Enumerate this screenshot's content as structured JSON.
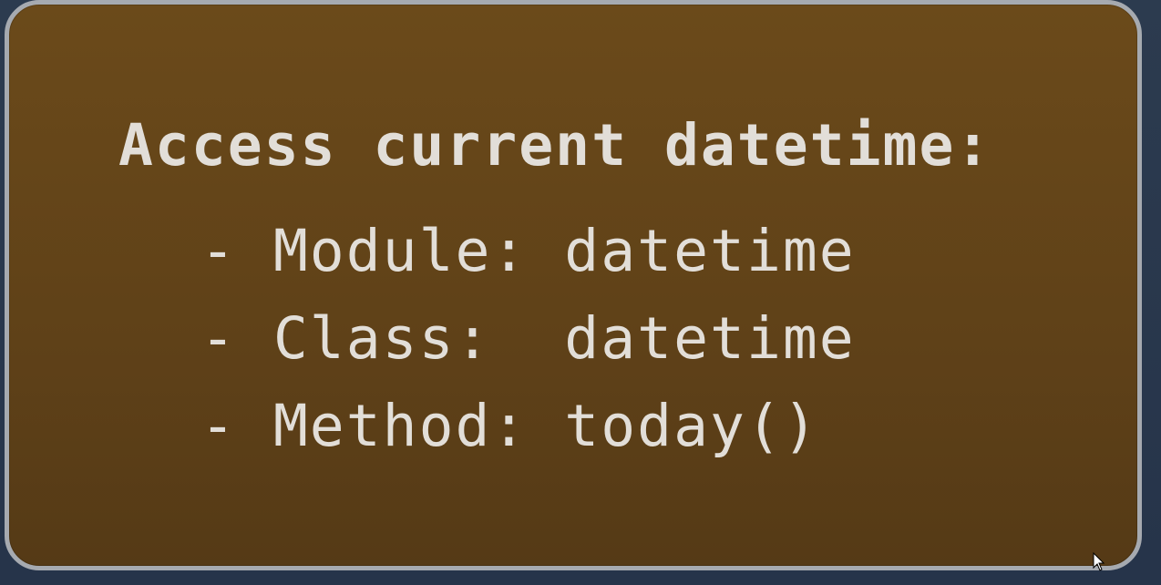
{
  "slide": {
    "heading": "Access current datetime:",
    "items": [
      {
        "text": "- Module: datetime"
      },
      {
        "text": "- Class:  datetime"
      },
      {
        "text": "- Method: today()"
      }
    ]
  },
  "colors": {
    "card_fill": "#5f4118",
    "card_border": "#a6aab0",
    "text": "#e2ded8",
    "background": "#2b3a4d"
  },
  "icons": {
    "cursor": "mouse-pointer-icon"
  }
}
